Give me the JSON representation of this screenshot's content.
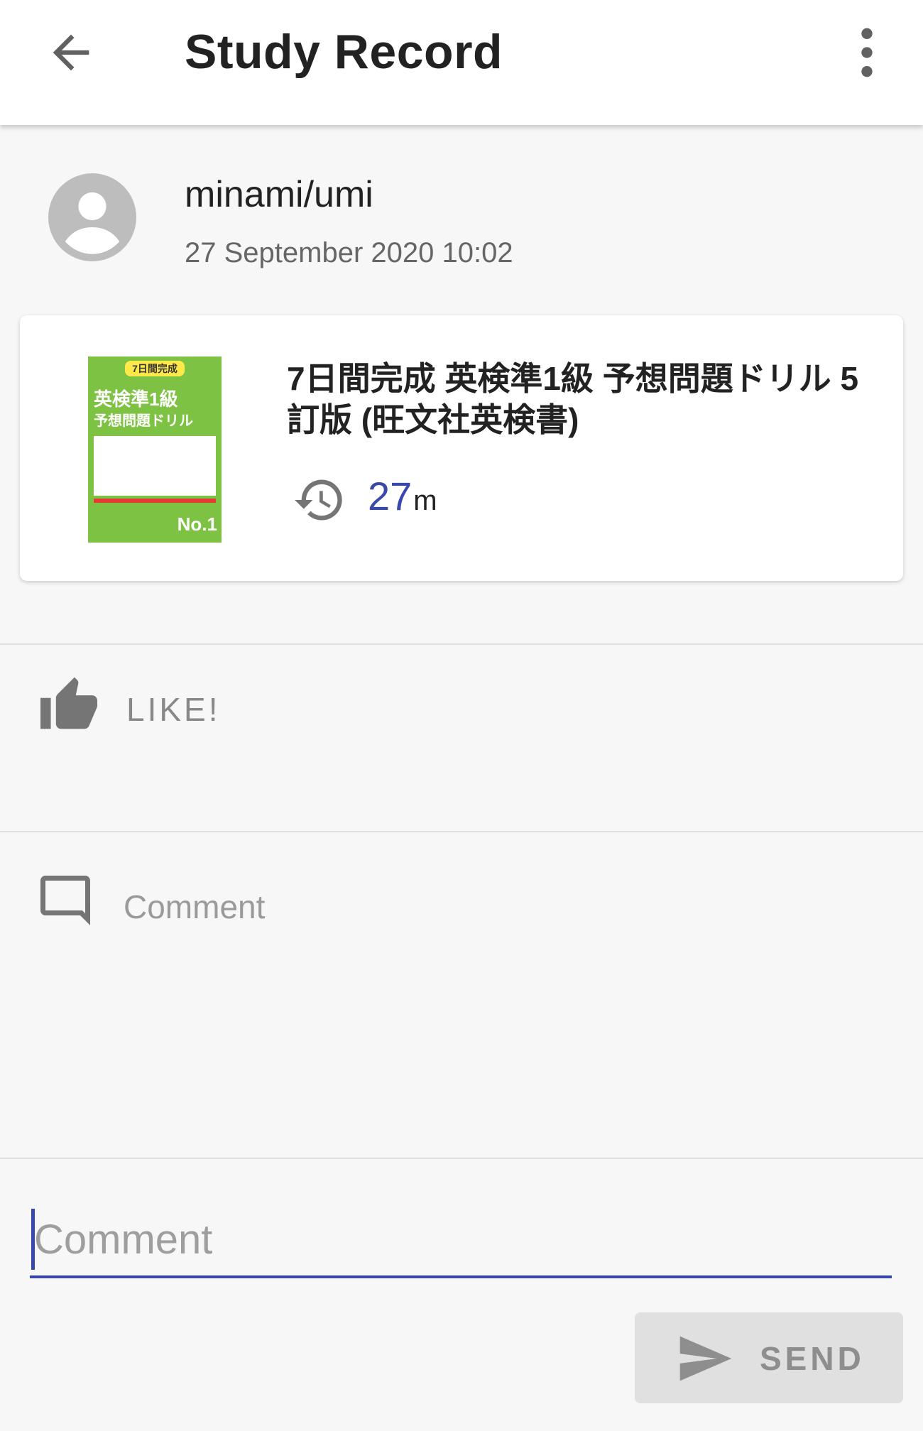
{
  "appbar": {
    "title": "Study Record",
    "back_icon": "arrow-back-icon",
    "menu_icon": "more-vertical-icon"
  },
  "post": {
    "avatar_icon": "account-circle-icon",
    "username": "minami/umi",
    "timestamp": "27 September 2020 10:02"
  },
  "record": {
    "book_title": "7日間完成 英検準1級 予想問題ドリル 5訂版 (旺文社英検書)",
    "cover": {
      "tag": "7日間完成",
      "title_line1": "英検準1級",
      "title_line2": "予想問題ドリル",
      "badge": "No.1",
      "background_color": "#7dc242"
    },
    "duration_value": "27",
    "duration_unit": "m",
    "timer_icon": "history-icon"
  },
  "like": {
    "icon": "thumb-up-icon",
    "label": "LIKE!"
  },
  "comments": {
    "icon": "comment-icon",
    "label": "Comment"
  },
  "composer": {
    "placeholder": "Comment",
    "value": "",
    "send_label": "SEND",
    "send_icon": "send-icon"
  },
  "colors": {
    "accent": "#3949ab",
    "icon_gray": "#757575",
    "background": "#f7f7f7"
  }
}
